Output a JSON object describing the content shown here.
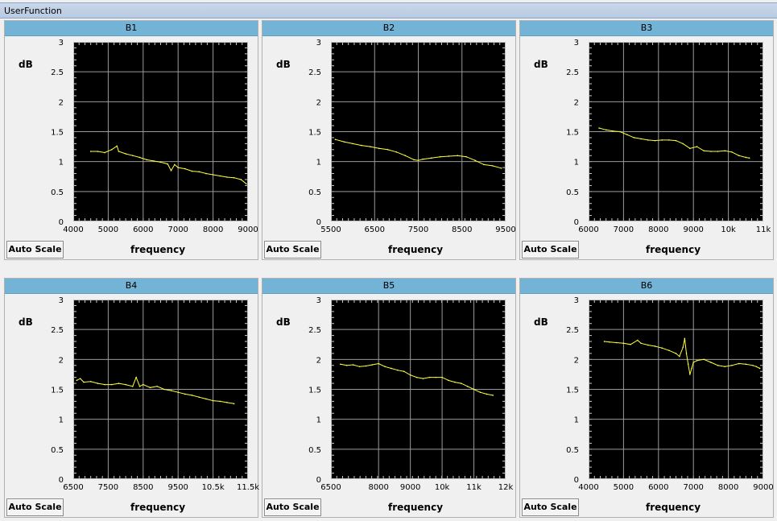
{
  "window": {
    "title": "UserFunction"
  },
  "panels": [
    {
      "title": "B1",
      "button_label": "Auto Scale",
      "xlabel": "frequency",
      "ylabel": "dB",
      "chart_data": {
        "type": "line",
        "title": "B1",
        "xlabel": "frequency",
        "ylabel": "dB",
        "xlim": [
          4000,
          9000
        ],
        "ylim": [
          0,
          3
        ],
        "xticks": [
          4000,
          5000,
          6000,
          7000,
          8000,
          9000
        ],
        "xtick_labels": [
          "4000",
          "5000",
          "6000",
          "7000",
          "8000",
          "9000"
        ],
        "yticks": [
          0,
          0.5,
          1,
          1.5,
          2,
          2.5,
          3
        ],
        "ytick_labels": [
          "0",
          "0.5",
          "1",
          "1.5",
          "2",
          "2.5",
          "3"
        ],
        "line_color": "#ffff40",
        "x": [
          4500,
          4700,
          4900,
          5100,
          5250,
          5300,
          5500,
          5700,
          5900,
          6100,
          6300,
          6500,
          6700,
          6800,
          6900,
          7000,
          7200,
          7400,
          7600,
          7800,
          8000,
          8200,
          8400,
          8600,
          8800,
          8950
        ],
        "y": [
          1.17,
          1.17,
          1.15,
          1.2,
          1.26,
          1.17,
          1.13,
          1.1,
          1.07,
          1.03,
          1.01,
          0.99,
          0.96,
          0.85,
          0.95,
          0.9,
          0.88,
          0.84,
          0.83,
          0.8,
          0.78,
          0.76,
          0.74,
          0.73,
          0.7,
          0.63
        ]
      }
    },
    {
      "title": "B2",
      "button_label": "Auto Scale",
      "xlabel": "frequency",
      "ylabel": "dB",
      "chart_data": {
        "type": "line",
        "title": "B2",
        "xlabel": "frequency",
        "ylabel": "dB",
        "xlim": [
          5500,
          9500
        ],
        "ylim": [
          0,
          3
        ],
        "xticks": [
          5500,
          6500,
          7500,
          8500,
          9500
        ],
        "xtick_labels": [
          "5500",
          "6500",
          "7500",
          "8500",
          "9500"
        ],
        "yticks": [
          0,
          0.5,
          1,
          1.5,
          2,
          2.5,
          3
        ],
        "ytick_labels": [
          "0",
          "0.5",
          "1",
          "1.5",
          "2",
          "2.5",
          "3"
        ],
        "line_color": "#ffff40",
        "x": [
          5600,
          5800,
          6000,
          6200,
          6400,
          6600,
          6800,
          7000,
          7200,
          7400,
          7500,
          7600,
          7800,
          8000,
          8200,
          8400,
          8600,
          8800,
          9000,
          9200,
          9400
        ],
        "y": [
          1.37,
          1.33,
          1.3,
          1.27,
          1.25,
          1.22,
          1.2,
          1.16,
          1.1,
          1.03,
          1.02,
          1.04,
          1.06,
          1.08,
          1.09,
          1.1,
          1.08,
          1.02,
          0.95,
          0.93,
          0.89
        ]
      }
    },
    {
      "title": "B3",
      "button_label": "Auto Scale",
      "xlabel": "frequency",
      "ylabel": "dB",
      "chart_data": {
        "type": "line",
        "title": "B3",
        "xlabel": "frequency",
        "ylabel": "dB",
        "xlim": [
          6000,
          11000
        ],
        "ylim": [
          0,
          3
        ],
        "xticks": [
          6000,
          7000,
          8000,
          9000,
          10000,
          11000
        ],
        "xtick_labels": [
          "6000",
          "7000",
          "8000",
          "9000",
          "10k",
          "11k"
        ],
        "yticks": [
          0,
          0.5,
          1,
          1.5,
          2,
          2.5,
          3
        ],
        "ytick_labels": [
          "0",
          "0.5",
          "1",
          "1.5",
          "2",
          "2.5",
          "3"
        ],
        "line_color": "#ffff40",
        "x": [
          6300,
          6500,
          6700,
          6900,
          7100,
          7300,
          7500,
          7700,
          7900,
          8100,
          8300,
          8500,
          8700,
          8900,
          9100,
          9300,
          9500,
          9700,
          9900,
          10100,
          10300,
          10500,
          10600
        ],
        "y": [
          1.56,
          1.53,
          1.51,
          1.5,
          1.45,
          1.4,
          1.38,
          1.36,
          1.35,
          1.36,
          1.36,
          1.35,
          1.3,
          1.22,
          1.25,
          1.18,
          1.17,
          1.17,
          1.18,
          1.16,
          1.1,
          1.07,
          1.06
        ]
      }
    },
    {
      "title": "B4",
      "button_label": "Auto Scale",
      "xlabel": "frequency",
      "ylabel": "dB",
      "chart_data": {
        "type": "line",
        "title": "B4",
        "xlabel": "frequency",
        "ylabel": "dB",
        "xlim": [
          6500,
          11500
        ],
        "ylim": [
          0,
          3
        ],
        "xticks": [
          6500,
          7500,
          8500,
          9500,
          10500,
          11500
        ],
        "xtick_labels": [
          "6500",
          "7500",
          "8500",
          "9500",
          "10.5k",
          "11.5k"
        ],
        "yticks": [
          0,
          0.5,
          1,
          1.5,
          2,
          2.5,
          3
        ],
        "ytick_labels": [
          "0",
          "0.5",
          "1",
          "1.5",
          "2",
          "2.5",
          "3"
        ],
        "line_color": "#ffff40",
        "x": [
          6600,
          6700,
          6800,
          7000,
          7200,
          7400,
          7600,
          7800,
          8000,
          8200,
          8300,
          8400,
          8500,
          8700,
          8900,
          9100,
          9300,
          9500,
          9700,
          9900,
          10100,
          10300,
          10500,
          10700,
          10900,
          11100
        ],
        "y": [
          1.65,
          1.68,
          1.62,
          1.63,
          1.6,
          1.58,
          1.58,
          1.6,
          1.58,
          1.55,
          1.7,
          1.55,
          1.58,
          1.53,
          1.55,
          1.5,
          1.48,
          1.45,
          1.42,
          1.4,
          1.37,
          1.34,
          1.31,
          1.3,
          1.28,
          1.26
        ]
      }
    },
    {
      "title": "B5",
      "button_label": "Auto Scale",
      "xlabel": "frequency",
      "ylabel": "dB",
      "chart_data": {
        "type": "line",
        "title": "B5",
        "xlabel": "frequency",
        "ylabel": "dB",
        "xlim": [
          6500,
          12000
        ],
        "ylim": [
          0,
          3
        ],
        "xticks": [
          6500,
          8000,
          9000,
          10000,
          11000,
          12000
        ],
        "xtick_labels": [
          "6500",
          "8000",
          "9000",
          "10k",
          "11k",
          "12k"
        ],
        "yticks": [
          0,
          0.5,
          1,
          1.5,
          2,
          2.5,
          3
        ],
        "ytick_labels": [
          "0",
          "0.5",
          "1",
          "1.5",
          "2",
          "2.5",
          "3"
        ],
        "line_color": "#ffff40",
        "x": [
          6800,
          7000,
          7200,
          7400,
          7600,
          7800,
          8000,
          8200,
          8400,
          8600,
          8800,
          9000,
          9200,
          9400,
          9600,
          9800,
          10000,
          10200,
          10400,
          10600,
          10800,
          11000,
          11200,
          11400,
          11600
        ],
        "y": [
          1.92,
          1.9,
          1.91,
          1.88,
          1.89,
          1.91,
          1.93,
          1.88,
          1.85,
          1.82,
          1.8,
          1.74,
          1.7,
          1.68,
          1.7,
          1.7,
          1.7,
          1.65,
          1.62,
          1.6,
          1.55,
          1.5,
          1.45,
          1.42,
          1.4
        ]
      }
    },
    {
      "title": "B6",
      "button_label": "Auto Scale",
      "xlabel": "frequency",
      "ylabel": "dB",
      "chart_data": {
        "type": "line",
        "title": "B6",
        "xlabel": "frequency",
        "ylabel": "dB",
        "xlim": [
          4000,
          9000
        ],
        "ylim": [
          0,
          3
        ],
        "xticks": [
          4000,
          5000,
          6000,
          7000,
          8000,
          9000
        ],
        "xtick_labels": [
          "4000",
          "5000",
          "6000",
          "7000",
          "8000",
          "9000"
        ],
        "yticks": [
          0,
          0.5,
          1,
          1.5,
          2,
          2.5,
          3
        ],
        "ytick_labels": [
          "0",
          "0.5",
          "1",
          "1.5",
          "2",
          "2.5",
          "3"
        ],
        "line_color": "#ffff40",
        "x": [
          4450,
          4600,
          4800,
          5000,
          5200,
          5400,
          5500,
          5700,
          5900,
          6100,
          6300,
          6500,
          6600,
          6700,
          6750,
          6800,
          6850,
          6900,
          6950,
          7000,
          7100,
          7300,
          7500,
          7700,
          7900,
          8100,
          8300,
          8500,
          8700,
          8800,
          8900
        ],
        "y": [
          2.3,
          2.29,
          2.28,
          2.27,
          2.25,
          2.32,
          2.27,
          2.24,
          2.22,
          2.19,
          2.15,
          2.1,
          2.05,
          2.2,
          2.35,
          2.1,
          1.92,
          1.75,
          1.85,
          1.95,
          1.98,
          2.0,
          1.95,
          1.9,
          1.88,
          1.9,
          1.93,
          1.92,
          1.9,
          1.88,
          1.85
        ]
      }
    }
  ]
}
